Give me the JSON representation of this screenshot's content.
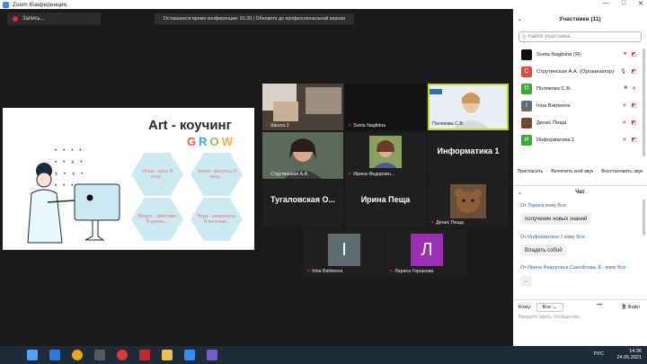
{
  "window": {
    "title": "Zoom Конференция",
    "controls": [
      "—",
      "□",
      "✕"
    ]
  },
  "recording": {
    "label": "Запись..."
  },
  "banner": {
    "text": "Оставшееся время конференции: 01:39 | Обновите до профессиональной версии"
  },
  "slide": {
    "title": "Art - коучинг",
    "grow_letters": [
      {
        "ch": "G",
        "color": "#e8604a"
      },
      {
        "ch": "R",
        "color": "#2ab6c9"
      },
      {
        "ch": "O",
        "color": "#8cc84b"
      },
      {
        "ch": "W",
        "color": "#f2b134"
      }
    ],
    "hexes": [
      "Огонь - цель Я хочу...",
      "Земля - ресурсы Я могу...",
      "Воздух - действие Я делаю...",
      "Вода - результаты Я получаю..."
    ],
    "dots": "•••• ••x• x•x• •••x"
  },
  "tiles": [
    {
      "label": "Школа 2",
      "mic_muted": true
    },
    {
      "label": "Sveta Nagibina",
      "mic_muted": true
    },
    {
      "label": "Полякова С.В.",
      "mic_muted": false
    },
    {
      "label": "Струтинская А.А.",
      "mic_muted": true
    },
    {
      "label": "Ирина Федоровн...",
      "mic_muted": true
    },
    {
      "label": "",
      "name_text": "Информатика 1",
      "mic_muted": true
    },
    {
      "label": "",
      "name_text": "Тугаловская О...",
      "mic_muted": true
    },
    {
      "label": "",
      "name_text": "Ирина Пеща",
      "mic_muted": true
    },
    {
      "label": "Денис Пеща",
      "mic_muted": true
    },
    {
      "label": "Irina Bahteeva",
      "letter": "I",
      "mic_muted": true
    },
    {
      "label": "Лариса Горшкова",
      "letter": "Л",
      "mic_muted": true
    }
  ],
  "participants": {
    "title": "Участники (11)",
    "search_placeholder": "Найти участника",
    "rows": [
      {
        "name": "Sveta Nagibina (Я)",
        "initial": "",
        "color": "#111111"
      },
      {
        "name": "Струтинская А.А. (Организатор)",
        "initial": "С",
        "color": "#e04a3a"
      },
      {
        "name": "Полякова С.В.",
        "initial": "П",
        "color": "#3aaa35"
      },
      {
        "name": "Irina Bahteeva",
        "initial": "I",
        "color": "#5f6d73"
      },
      {
        "name": "Денис Пеща",
        "initial": "",
        "color": "#6b4a2f"
      },
      {
        "name": "Информатика 1",
        "initial": "И",
        "color": "#3aaa35"
      }
    ],
    "buttons": [
      "Пригласить",
      "Включить мой звук",
      "Восстановить звук"
    ]
  },
  "chat": {
    "title": "Чат",
    "messages": [
      {
        "from": "Лариса",
        "mid": "кому",
        "to": "Все",
        "text": "получение новых знаний"
      },
      {
        "from": "Информатика 1",
        "mid": "кому",
        "to": "Все",
        "text": "Владеть собой"
      },
      {
        "from": "Ирина Федоровна Самойлова. Е..",
        "mid": "кому",
        "to": "Все",
        "text": ".."
      }
    ],
    "to_label": "Кому:",
    "to_value": "Все",
    "file_label": "Файл",
    "placeholder": "Введите здесь сообщение..."
  },
  "taskbar": {
    "lang": "РУС",
    "time": "14:36",
    "date": "24.05.2021",
    "icons": [
      "windows-icon",
      "search-icon",
      "edge-icon",
      "chrome-icon",
      "files-icon",
      "yandex-icon",
      "pdf-icon",
      "zoom-icon",
      "folder-icon",
      "app-icon"
    ]
  }
}
